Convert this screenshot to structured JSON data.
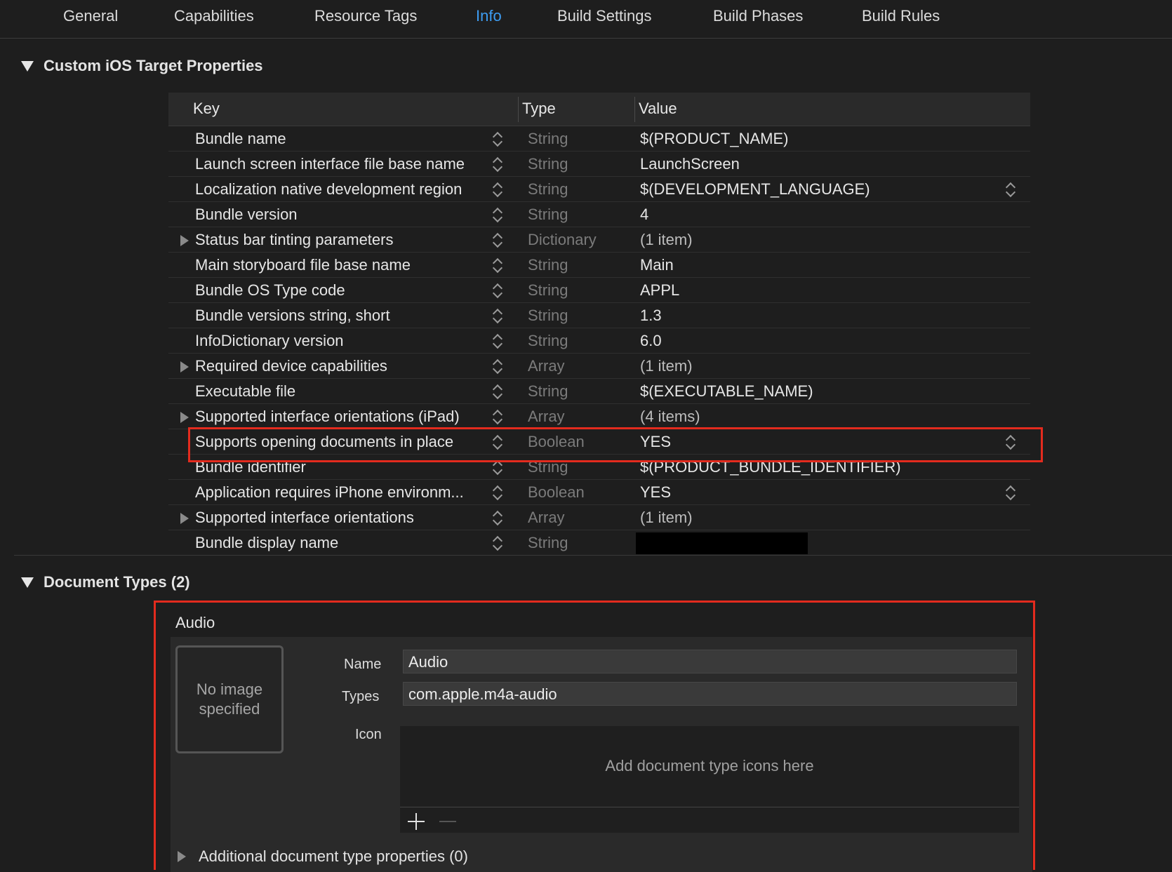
{
  "tabs": [
    {
      "label": "General"
    },
    {
      "label": "Capabilities"
    },
    {
      "label": "Resource Tags"
    },
    {
      "label": "Info"
    },
    {
      "label": "Build Settings"
    },
    {
      "label": "Build Phases"
    },
    {
      "label": "Build Rules"
    }
  ],
  "active_tab": "Info",
  "colors": {
    "accent": "#3d9df3",
    "highlight_border": "#e32b1e",
    "background": "#1e1e1e"
  },
  "custom_properties": {
    "title": "Custom iOS Target Properties",
    "columns": {
      "key": "Key",
      "type": "Type",
      "value": "Value"
    },
    "rows": [
      {
        "key": "Bundle name",
        "type": "String",
        "value": "$(PRODUCT_NAME)"
      },
      {
        "key": "Launch screen interface file base name",
        "type": "String",
        "value": "LaunchScreen"
      },
      {
        "key": "Localization native development region",
        "type": "String",
        "value": "$(DEVELOPMENT_LANGUAGE)"
      },
      {
        "key": "Bundle version",
        "type": "String",
        "value": "4"
      },
      {
        "key": "Status bar tinting parameters",
        "type": "Dictionary",
        "value": "(1 item)"
      },
      {
        "key": "Main storyboard file base name",
        "type": "String",
        "value": "Main"
      },
      {
        "key": "Bundle OS Type code",
        "type": "String",
        "value": "APPL"
      },
      {
        "key": "Bundle versions string, short",
        "type": "String",
        "value": "1.3"
      },
      {
        "key": "InfoDictionary version",
        "type": "String",
        "value": "6.0"
      },
      {
        "key": "Required device capabilities",
        "type": "Array",
        "value": "(1 item)"
      },
      {
        "key": "Executable file",
        "type": "String",
        "value": "$(EXECUTABLE_NAME)"
      },
      {
        "key": "Supported interface orientations (iPad)",
        "type": "Array",
        "value": "(4 items)"
      },
      {
        "key": "Supports opening documents in place",
        "type": "Boolean",
        "value": "YES"
      },
      {
        "key": "Bundle identifier",
        "type": "String",
        "value": "$(PRODUCT_BUNDLE_IDENTIFIER)"
      },
      {
        "key": "Application requires iPhone environm...",
        "type": "Boolean",
        "value": "YES"
      },
      {
        "key": "Supported interface orientations",
        "type": "Array",
        "value": "(1 item)"
      },
      {
        "key": "Bundle display name",
        "type": "String",
        "value": ""
      }
    ]
  },
  "document_types": {
    "title": "Document Types (2)",
    "entry": {
      "title": "Audio",
      "image_placeholder": "No image specified",
      "name_label": "Name",
      "name_value": "Audio",
      "types_label": "Types",
      "types_value": "com.apple.m4a-audio",
      "icon_label": "Icon",
      "icon_placeholder": "Add document type icons here",
      "additional_properties": "Additional document type properties (0)"
    }
  }
}
